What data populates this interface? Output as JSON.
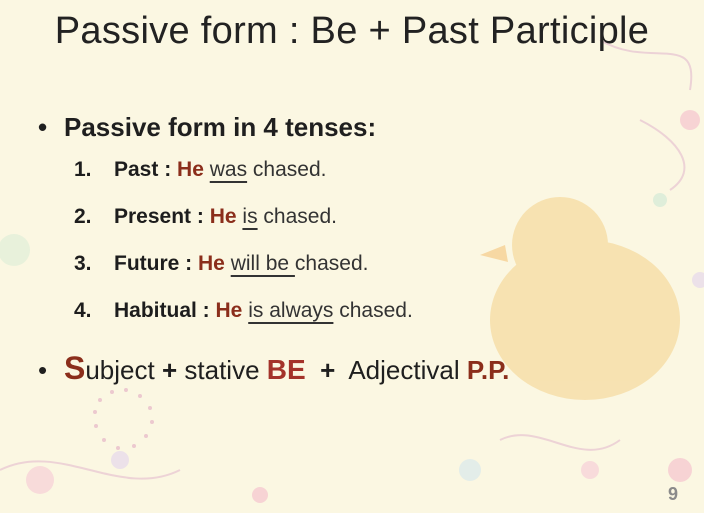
{
  "slide": {
    "title": "Passive form : Be + Past Participle",
    "bullet1": "Passive form in 4 tenses:",
    "tenses": [
      {
        "num": "1.",
        "label": "Past :",
        "subject": "He",
        "verb": "was",
        "tail": " chased."
      },
      {
        "num": "2.",
        "label": "Present :",
        "subject": "He",
        "verb": "is",
        "tail": " chased."
      },
      {
        "num": "3.",
        "label": "Future :",
        "subject": "He",
        "verb": "will be ",
        "tail": "chased."
      },
      {
        "num": "4.",
        "label": "Habitual :",
        "subject": "He",
        "verb": "is always",
        "tail": " chased."
      }
    ],
    "bullet2": {
      "s_letter": "S",
      "subject_rest": "ubject",
      "plus1": "+",
      "stative": "stative",
      "be": "BE",
      "plus2": "+",
      "adjectival": "Adjectival",
      "pp": "P.P."
    },
    "page_number": "9"
  },
  "colors": {
    "background": "#fbf7e2",
    "accent_red": "#8b2e1b",
    "be_red": "#a4332a",
    "bird": "#f4d28a"
  }
}
